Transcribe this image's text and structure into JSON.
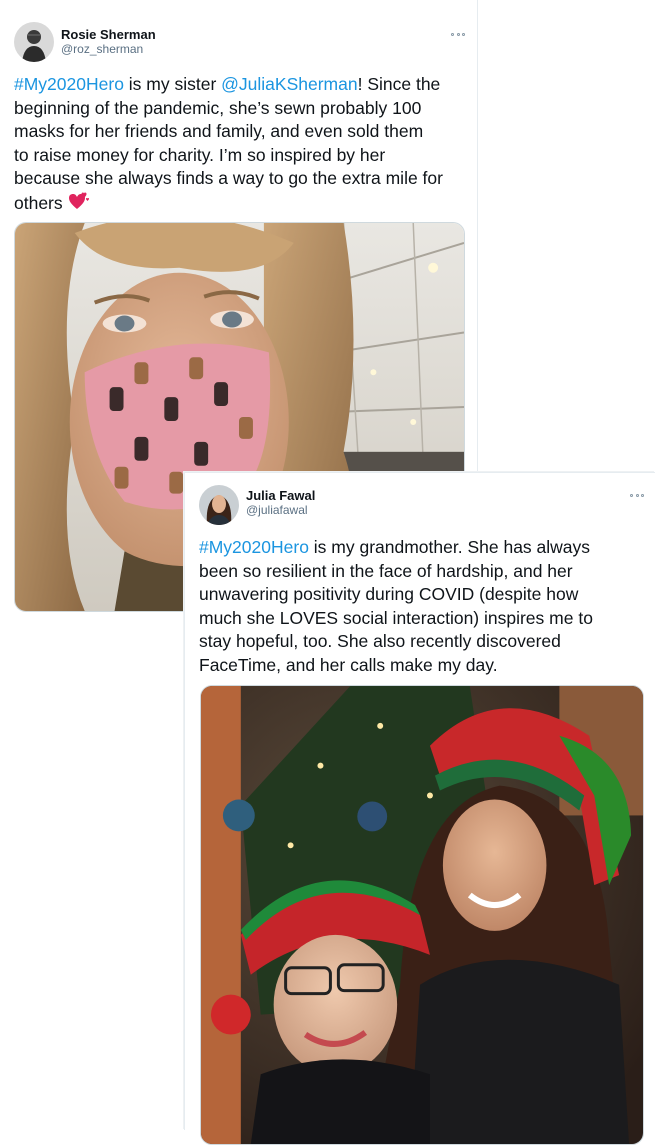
{
  "tweets": [
    {
      "name": "Rosie Sherman",
      "handle": "@roz_sherman",
      "hashtag": "#My2020Hero",
      "text_a": " is my sister ",
      "mention": "@JuliaKSherman",
      "text_b": "! Since the",
      "lines": [
        "beginning of the pandemic, she’s sewn probably 100",
        "masks for her friends and family, and even sold them",
        "to raise money for charity. I’m so inspired by her",
        "because she always finds a way to go the extra mile for"
      ],
      "last_line": "others",
      "emoji": "heart-with-hearts-icon",
      "media": "photo of a woman with blonde hair wearing a pink face mask"
    },
    {
      "name": "Julia Fawal",
      "handle": "@juliafawal",
      "hashtag": "#My2020Hero",
      "text_a": " is my grandmother. She has always",
      "lines": [
        "been so resilient in the face of hardship, and her",
        "unwavering positivity during COVID (despite how",
        "much she LOVES social interaction) inspires me to",
        "stay hopeful, too. She also recently discovered",
        "FaceTime, and her calls make my day."
      ],
      "media": "photo of a young woman and her grandmother in red elf hats in front of a Christmas tree"
    }
  ],
  "colors": {
    "link": "#1b95e0",
    "text": "#0f1419",
    "handle": "#5b7083"
  }
}
